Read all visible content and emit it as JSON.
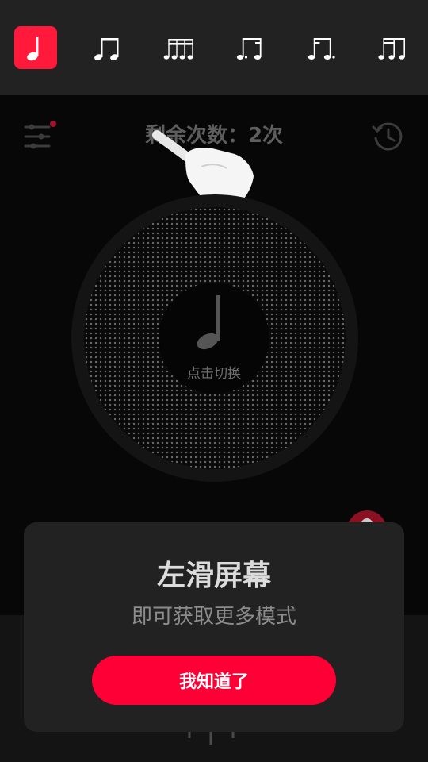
{
  "rhythm_bar": {
    "items": [
      {
        "icon": "quarter-note-icon",
        "active": true
      },
      {
        "icon": "eighth-notes-icon",
        "active": false
      },
      {
        "icon": "sixteenth-notes-icon",
        "active": false
      },
      {
        "icon": "dotted-eighth-sixteenth-icon",
        "active": false
      },
      {
        "icon": "sixteenth-dotted-eighth-icon",
        "active": false
      },
      {
        "icon": "triplet-notes-icon",
        "active": false
      }
    ],
    "active_color": "#ff1a3c"
  },
  "header": {
    "remaining_count": "剩余次数：2次",
    "settings_icon": "sliders-icon",
    "history_icon": "history-icon",
    "notification_color": "#ff1a3c"
  },
  "dial": {
    "label": "点击切换",
    "icon": "quarter-note-icon"
  },
  "guide": {
    "title": "左滑屏幕",
    "subtitle": "即可获取更多模式",
    "button": "我知道了",
    "button_color": "#ff0036",
    "hand_icon": "pointing-hand-icon"
  }
}
